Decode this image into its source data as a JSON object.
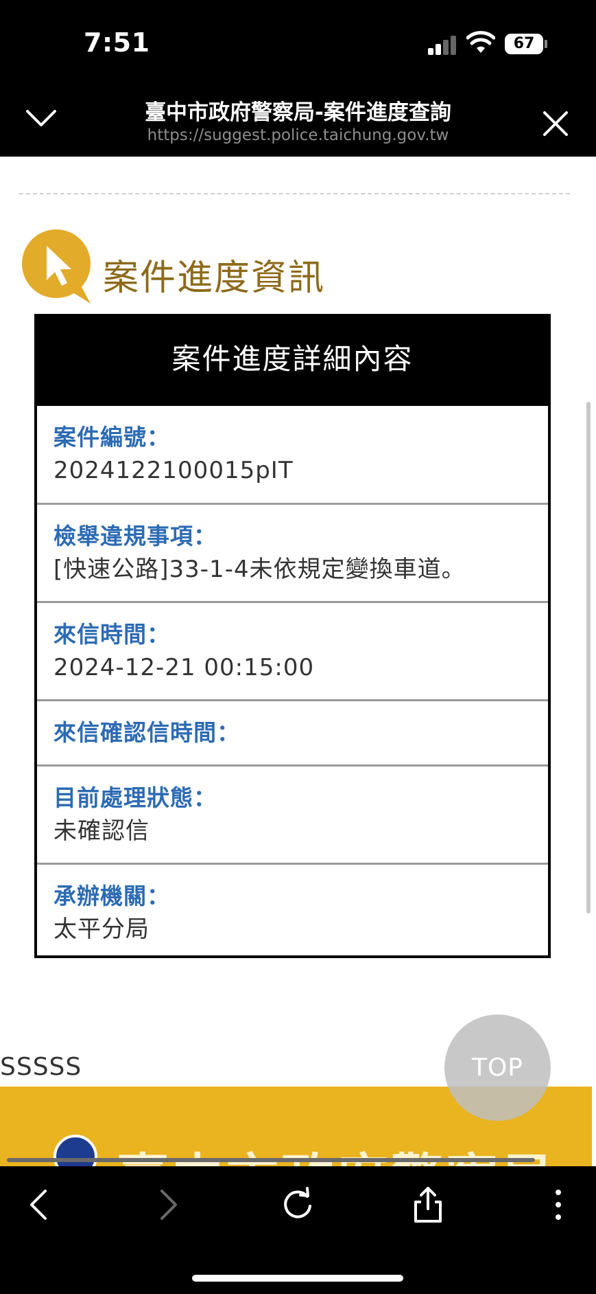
{
  "status_bar": {
    "time": "7:51",
    "battery": "67"
  },
  "browser": {
    "title": "臺中市政府警察局-案件進度查詢",
    "url": "https://suggest.police.taichung.gov.tw"
  },
  "section": {
    "title": "案件進度資訊"
  },
  "card": {
    "header": "案件進度詳細內容",
    "rows": [
      {
        "label": "案件編號：",
        "value": "2024122100015pIT"
      },
      {
        "label": "檢舉違規事項：",
        "value": "[快速公路]33-1-4未依規定變換車道。"
      },
      {
        "label": "來信時間：",
        "value": "2024-12-21 00:15:00"
      },
      {
        "label": "來信確認信時間：",
        "value": ""
      },
      {
        "label": "目前處理狀態：",
        "value": "未確認信"
      },
      {
        "label": "承辦機關：",
        "value": "太平分局"
      }
    ]
  },
  "footer": {
    "text": "SSSSS",
    "top_button": "TOP",
    "banner_text": "臺中市政府警察局"
  },
  "colors": {
    "label_blue": "#2d6bb3",
    "gold": "#eab320",
    "title_gold": "#8d6a1a"
  }
}
